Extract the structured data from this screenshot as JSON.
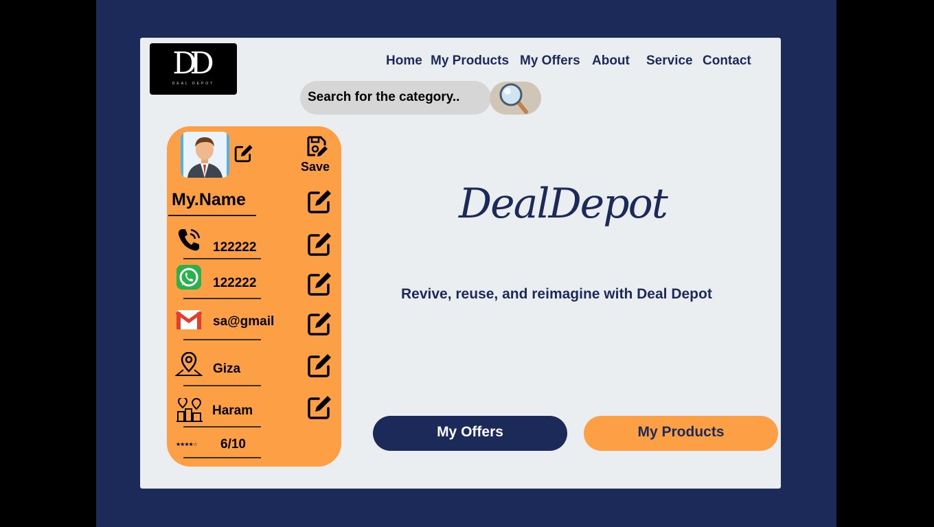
{
  "logo": {
    "monogram": "DD",
    "small_text": "DEAL DEPOT"
  },
  "nav": {
    "items": [
      "Home",
      "My Products",
      "My Offers",
      "About",
      "Service",
      "Contact"
    ]
  },
  "search": {
    "placeholder": "Search for the category.."
  },
  "profile": {
    "save_label": "Save",
    "name": "My.Name",
    "phone": "122222",
    "whatsapp": "122222",
    "email": "sa@gmail",
    "city": "Giza",
    "district": "Haram",
    "rating_stars": "★★★★☆",
    "rating": "6/10"
  },
  "main": {
    "brand": "DealDepot",
    "tagline": "Revive, reuse, and reimagine with Deal Depot"
  },
  "buttons": {
    "offers": "My Offers",
    "products": "My Products"
  },
  "colors": {
    "navy": "#1b2a58",
    "orange": "#fd9f44",
    "panel": "#ebeef0"
  }
}
